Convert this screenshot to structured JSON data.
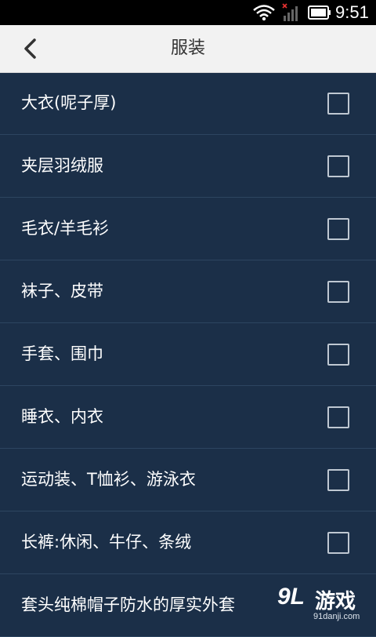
{
  "status_bar": {
    "time": "9:51",
    "icons": [
      "wifi-icon",
      "signal-icon",
      "battery-icon"
    ]
  },
  "header": {
    "title": "服装",
    "back_icon": "chevron-left-icon"
  },
  "items": [
    {
      "label": "大衣(呢子厚)",
      "checked": false
    },
    {
      "label": "夹层羽绒服",
      "checked": false
    },
    {
      "label": "毛衣/羊毛衫",
      "checked": false
    },
    {
      "label": "袜子、皮带",
      "checked": false
    },
    {
      "label": "手套、围巾",
      "checked": false
    },
    {
      "label": "睡衣、内衣",
      "checked": false
    },
    {
      "label": "运动装、T恤衫、游泳衣",
      "checked": false
    },
    {
      "label": "长裤:休闲、牛仔、条绒",
      "checked": false
    },
    {
      "label": "套头纯棉帽子防水的厚实外套",
      "checked": false
    }
  ],
  "watermark": {
    "logo": "9L",
    "name": "游戏",
    "url": "91danji.com"
  },
  "colors": {
    "background": "#1b2f48",
    "header": "#f2f2f2",
    "divider": "#2d4560",
    "checkbox": "#bfc8d2"
  }
}
